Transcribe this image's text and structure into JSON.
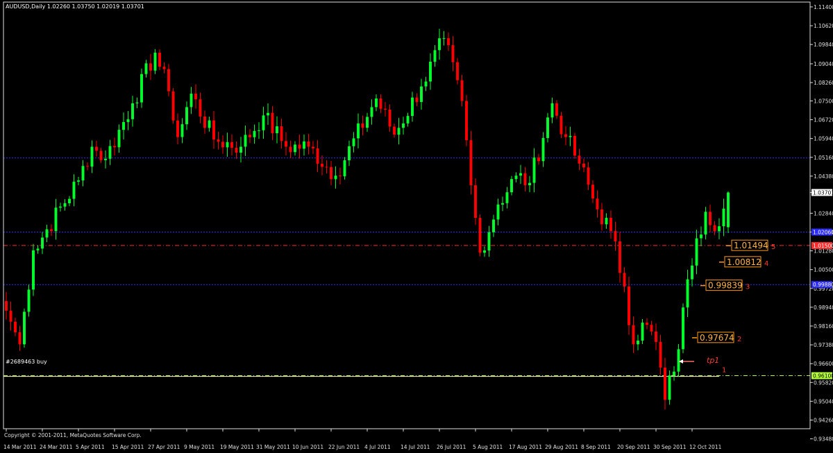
{
  "window": {
    "title": "AUDUSD,Daily  1.02260 1.03750 1.02019 1.03701",
    "copyright": "Copyright © 2001-2011, MetaQuotes Software Corp.",
    "order_label": "#2689463 buy"
  },
  "colors": {
    "background": "#000000",
    "bull": "#00ff2a",
    "bear": "#ff0000",
    "axis": "#e0e0e0",
    "blue_line": "#2a2aff",
    "red_line": "#ff2a2a",
    "green_line": "#b4ff3a",
    "level_box": "#ff9a1a",
    "tp_text": "#ff3b2f"
  },
  "chart_data": {
    "type": "candlestick",
    "symbol": "AUDUSD",
    "timeframe": "Daily",
    "title": "AUDUSD,Daily  1.02260 1.03750 1.02019 1.03701",
    "ohlc_last": {
      "open": 1.0226,
      "high": 1.0375,
      "low": 1.02019,
      "close": 1.03701
    },
    "ylim": [
      0.939,
      1.116
    ],
    "y_ticks": [
      "1.11400",
      "1.10620",
      "1.09840",
      "1.09040",
      "1.08260",
      "1.07500",
      "1.06720",
      "1.05940",
      "1.05160",
      "1.04380",
      "1.03701",
      "1.02840",
      "1.02060",
      "1.01280",
      "1.00500",
      "0.99720",
      "0.98940",
      "0.98160",
      "0.97380",
      "0.96600",
      "0.95820",
      "0.95040",
      "0.94260",
      "0.93480"
    ],
    "x_ticks": [
      "14 Mar 2011",
      "24 Mar 2011",
      "5 Apr 2011",
      "15 Apr 2011",
      "27 Apr 2011",
      "9 May 2011",
      "19 May 2011",
      "31 May 2011",
      "10 Jun 2011",
      "22 Jun 2011",
      "4 Jul 2011",
      "14 Jul 2011",
      "26 Jul 2011",
      "5 Aug 2011",
      "17 Aug 2011",
      "29 Aug 2011",
      "8 Sep 2011",
      "20 Sep 2011",
      "30 Sep 2011",
      "12 Oct 2011"
    ],
    "anchors": [
      {
        "date": "14 Mar 2011",
        "close": 0.988
      },
      {
        "date": "16 Mar 2011",
        "close": 0.979
      },
      {
        "date": "17 Mar 2011",
        "close": 0.974
      },
      {
        "date": "22 Mar 2011",
        "close": 1.013
      },
      {
        "date": "5 Apr 2011",
        "close": 1.042
      },
      {
        "date": "8 Apr 2011",
        "close": 1.056
      },
      {
        "date": "13 Apr 2011",
        "close": 1.051
      },
      {
        "date": "21 Apr 2011",
        "close": 1.074
      },
      {
        "date": "28 Apr 2011",
        "close": 1.095
      },
      {
        "date": "3 May 2011",
        "close": 1.079
      },
      {
        "date": "5 May 2011",
        "close": 1.06
      },
      {
        "date": "10 May 2011",
        "close": 1.078
      },
      {
        "date": "17 May 2011",
        "close": 1.059
      },
      {
        "date": "25 May 2011",
        "close": 1.056
      },
      {
        "date": "1 Jun 2011",
        "close": 1.069
      },
      {
        "date": "8 Jun 2011",
        "close": 1.056
      },
      {
        "date": "15 Jun 2011",
        "close": 1.056
      },
      {
        "date": "23 Jun 2011",
        "close": 1.044
      },
      {
        "date": "6 Jul 2011",
        "close": 1.076
      },
      {
        "date": "12 Jul 2011",
        "close": 1.061
      },
      {
        "date": "20 Jul 2011",
        "close": 1.081
      },
      {
        "date": "27 Jul 2011",
        "close": 1.101
      },
      {
        "date": "2 Aug 2011",
        "close": 1.075
      },
      {
        "date": "4 Aug 2011",
        "close": 1.04
      },
      {
        "date": "8 Aug 2011",
        "close": 1.012
      },
      {
        "date": "12 Aug 2011",
        "close": 1.032
      },
      {
        "date": "18 Aug 2011",
        "close": 1.044
      },
      {
        "date": "23 Aug 2011",
        "close": 1.041
      },
      {
        "date": "30 Aug 2011",
        "close": 1.074
      },
      {
        "date": "2 Sep 2011",
        "close": 1.06
      },
      {
        "date": "7 Sep 2011",
        "close": 1.049
      },
      {
        "date": "13 Sep 2011",
        "close": 1.03
      },
      {
        "date": "16 Sep 2011",
        "close": 1.021
      },
      {
        "date": "21 Sep 2011",
        "close": 0.998
      },
      {
        "date": "23 Sep 2011",
        "close": 0.974
      },
      {
        "date": "27 Sep 2011",
        "close": 0.983
      },
      {
        "date": "30 Sep 2011",
        "close": 0.975
      },
      {
        "date": "4 Oct 2011",
        "close": 0.951
      },
      {
        "date": "7 Oct 2011",
        "close": 0.972
      },
      {
        "date": "11 Oct 2011",
        "close": 1.001
      },
      {
        "date": "13 Oct 2011",
        "close": 1.018
      },
      {
        "date": "17 Oct 2011",
        "close": 1.029
      },
      {
        "date": "20 Oct 2011",
        "close": 1.023
      },
      {
        "date": "24 Oct 2011",
        "close": 1.037
      }
    ],
    "horizontal_lines": [
      {
        "price": 1.0513,
        "style": "dotted",
        "color": "#2a2aff"
      },
      {
        "price": 1.0206,
        "style": "dotted",
        "color": "#2a2aff"
      },
      {
        "price": 0.9988,
        "style": "dotted",
        "color": "#2a2aff"
      },
      {
        "price": 1.015,
        "style": "dashdot",
        "color": "#ff2a2a"
      },
      {
        "price": 0.961,
        "style": "dashdot",
        "color": "#b4ff3a"
      },
      {
        "price": 0.9607,
        "style": "solid",
        "color": "#ffffcc"
      }
    ],
    "price_tags": [
      {
        "text": "1.03701",
        "price": 1.03701,
        "bg": "#ffffff",
        "fg": "#000000"
      },
      {
        "text": "1.02060",
        "price": 1.0206,
        "bg": "#2a2aff",
        "fg": "#ffffff"
      },
      {
        "text": "1.01500",
        "price": 1.015,
        "bg": "#ff2a2a",
        "fg": "#ffffff"
      },
      {
        "text": "0.99880",
        "price": 0.9988,
        "bg": "#2a2aff",
        "fg": "#ffffff"
      },
      {
        "text": "0.96100",
        "price": 0.961,
        "bg": "#b4ff3a",
        "fg": "#000000"
      }
    ],
    "levels": [
      {
        "value": "1.01494",
        "num": "5",
        "price": 1.01494
      },
      {
        "value": "1.00812",
        "num": "4",
        "price": 1.00812
      },
      {
        "value": "0.99839",
        "num": "3",
        "price": 0.99839
      },
      {
        "value": "0.97674",
        "num": "2",
        "price": 0.97674
      }
    ],
    "tp_label": "tp1",
    "tp_price": 0.9669,
    "level1_num": "1",
    "level1_price": 0.963
  }
}
